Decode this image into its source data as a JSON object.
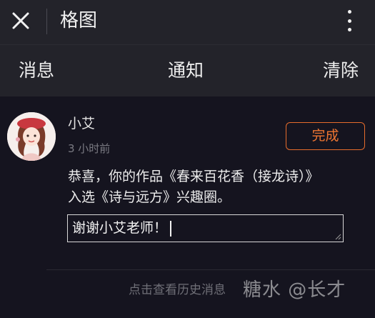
{
  "header": {
    "title": "格图",
    "close_icon": "close-icon",
    "more_icon": "more-vertical-icon"
  },
  "tabs": {
    "messages": "消息",
    "notify": "通知",
    "clear": "清除"
  },
  "notification": {
    "username": "小艾",
    "time": "3 小时前",
    "action_label": "完成",
    "message": "恭喜，你的作品《春来百花香（接龙诗）》入选《诗与远方》兴趣圈。",
    "reply_value": "谢谢小艾老师！",
    "avatar_icon": "avatar-icon"
  },
  "footer": {
    "history_link": "点击查看历史消息",
    "watermark": "糖水 @长才"
  },
  "colors": {
    "background": "#15141f",
    "bar": "#23232a",
    "accent": "#e66c2c"
  }
}
